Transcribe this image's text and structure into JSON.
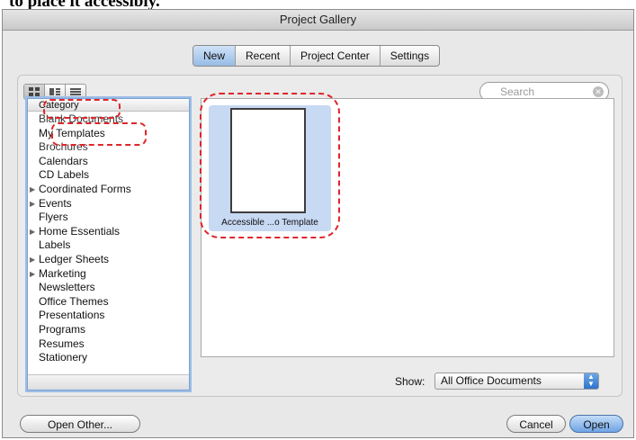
{
  "page": {
    "cropped_caption": "to place it accessibly."
  },
  "window": {
    "title": "Project Gallery"
  },
  "tabs": [
    {
      "label": "New",
      "active": true
    },
    {
      "label": "Recent",
      "active": false
    },
    {
      "label": "Project Center",
      "active": false
    },
    {
      "label": "Settings",
      "active": false
    }
  ],
  "view_buttons": [
    "icon-view-icon",
    "list-detail-view-icon",
    "list-view-icon"
  ],
  "search": {
    "placeholder": "Search"
  },
  "categories": {
    "header": "Category",
    "items": [
      {
        "label": "Blank Documents",
        "expandable": false
      },
      {
        "label": "My Templates",
        "expandable": false
      },
      {
        "label": "Brochures",
        "expandable": false
      },
      {
        "label": "Calendars",
        "expandable": false
      },
      {
        "label": "CD Labels",
        "expandable": false
      },
      {
        "label": "Coordinated Forms",
        "expandable": true
      },
      {
        "label": "Events",
        "expandable": true
      },
      {
        "label": "Flyers",
        "expandable": false
      },
      {
        "label": "Home Essentials",
        "expandable": true
      },
      {
        "label": "Labels",
        "expandable": false
      },
      {
        "label": "Ledger Sheets",
        "expandable": true
      },
      {
        "label": "Marketing",
        "expandable": true
      },
      {
        "label": "Newsletters",
        "expandable": false
      },
      {
        "label": "Office Themes",
        "expandable": false
      },
      {
        "label": "Presentations",
        "expandable": false
      },
      {
        "label": "Programs",
        "expandable": false
      },
      {
        "label": "Resumes",
        "expandable": false
      },
      {
        "label": "Stationery",
        "expandable": false
      }
    ]
  },
  "gallery": {
    "template_label": "Accessible ...o Template"
  },
  "show": {
    "label": "Show:",
    "value": "All Office Documents"
  },
  "buttons": {
    "open_other": "Open Other...",
    "cancel": "Cancel",
    "open": "Open"
  },
  "colors": {
    "annotation": "#e0252b",
    "selection": "#c7d9f3",
    "accent": "#6ea4e6"
  }
}
